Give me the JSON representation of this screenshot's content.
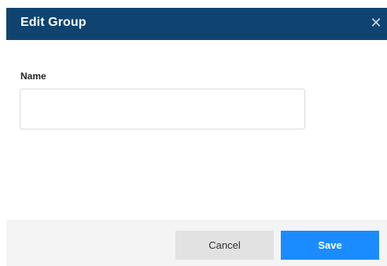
{
  "dialog": {
    "title": "Edit Group",
    "close_glyph": "✕"
  },
  "form": {
    "name_label": "Name",
    "name_value": "",
    "name_placeholder": ""
  },
  "footer": {
    "cancel_label": "Cancel",
    "save_label": "Save"
  },
  "colors": {
    "header_bg": "#0f4470",
    "save_bg": "#1a8cff",
    "cancel_bg": "#e2e2e2",
    "footer_bg": "#f4f4f4"
  },
  "icons": {
    "close": "close-icon"
  }
}
